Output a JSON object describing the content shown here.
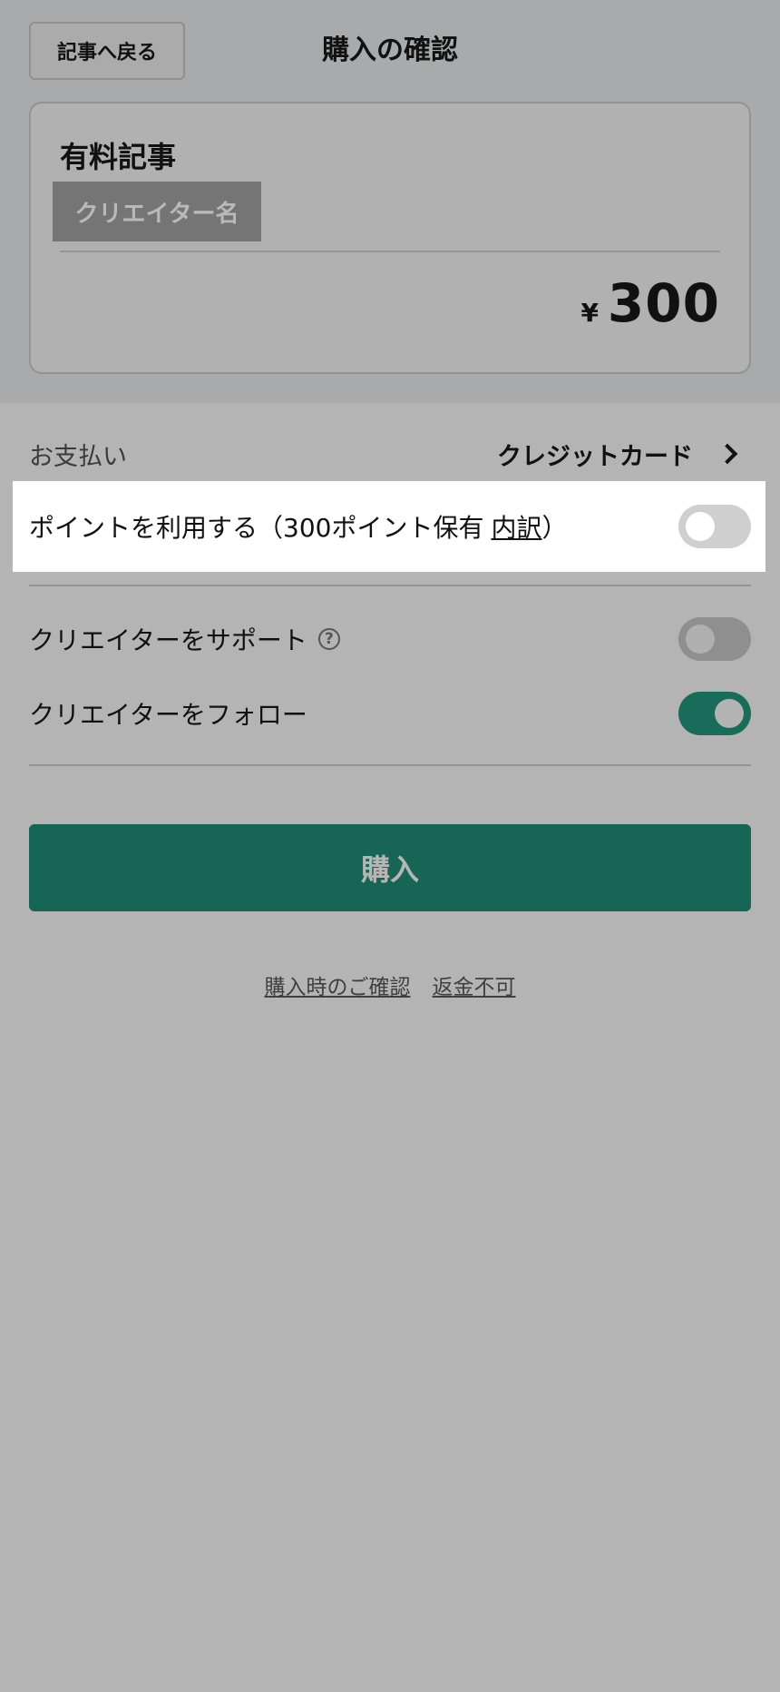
{
  "header": {
    "back_label": "記事へ戻る",
    "title": "購入の確認"
  },
  "article": {
    "title": "有料記事",
    "creator_name": "クリエイター名",
    "price_currency": "¥",
    "price_amount": "300"
  },
  "payment": {
    "label": "お支払い",
    "method": "クレジットカード"
  },
  "points": {
    "text": "ポイントを利用する（300ポイント保有",
    "link": "内訳",
    "suffix": "）",
    "enabled": false
  },
  "options": [
    {
      "label": "クリエイターをサポート",
      "enabled": false
    },
    {
      "label": "クリエイターをフォロー",
      "enabled": true
    }
  ],
  "purchase_button": {
    "label": "購入"
  },
  "footer": {
    "confirm_link": "購入時のご確認",
    "refund_link": "返金不可"
  },
  "colors": {
    "accent": "#196c59",
    "overlay": "#b4b4b4",
    "highlight": "#ffffff"
  }
}
